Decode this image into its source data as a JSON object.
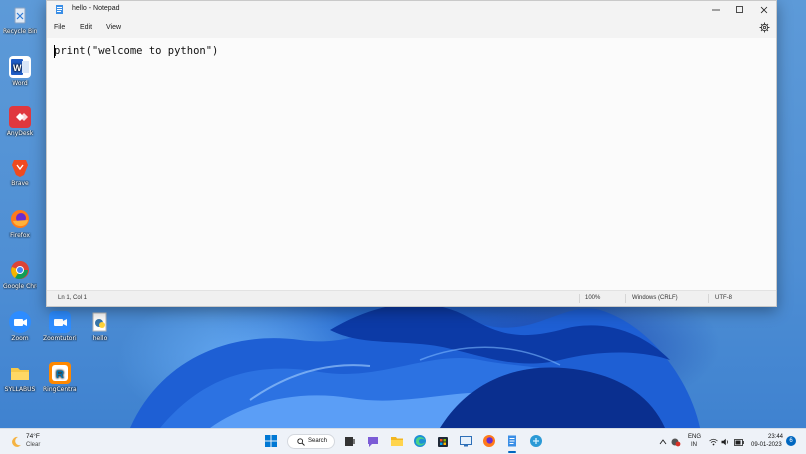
{
  "desktop": {
    "icons": [
      {
        "label": "Recycle Bin"
      },
      {
        "label": "Word"
      },
      {
        "label": "AnyDesk"
      },
      {
        "label": "Brave"
      },
      {
        "label": "Firefox"
      },
      {
        "label": "Google Chrome"
      },
      {
        "label": "Zoom"
      },
      {
        "label": "Zoomtutorial..."
      },
      {
        "label": "hello"
      },
      {
        "label": "SYLLABUS"
      },
      {
        "label": "RingCentral"
      }
    ]
  },
  "window": {
    "title": "hello - Notepad",
    "menu": [
      "File",
      "Edit",
      "View"
    ],
    "content": "print(\"welcome to python\")",
    "status": {
      "position": "Ln 1, Col 1",
      "zoom": "100%",
      "line_ending": "Windows (CRLF)",
      "encoding": "UTF-8"
    }
  },
  "taskbar": {
    "weather": {
      "temp": "74°F",
      "condition": "Clear"
    },
    "search_label": "Search",
    "language": {
      "lang": "ENG",
      "region": "IN"
    },
    "clock": {
      "time": "23:44",
      "date": "09-01-2023"
    },
    "notification_count": "6"
  },
  "colors": {
    "accent": "#0067c0",
    "window_bg": "#f9f9f9",
    "taskbar_bg": "#eef2f8"
  }
}
